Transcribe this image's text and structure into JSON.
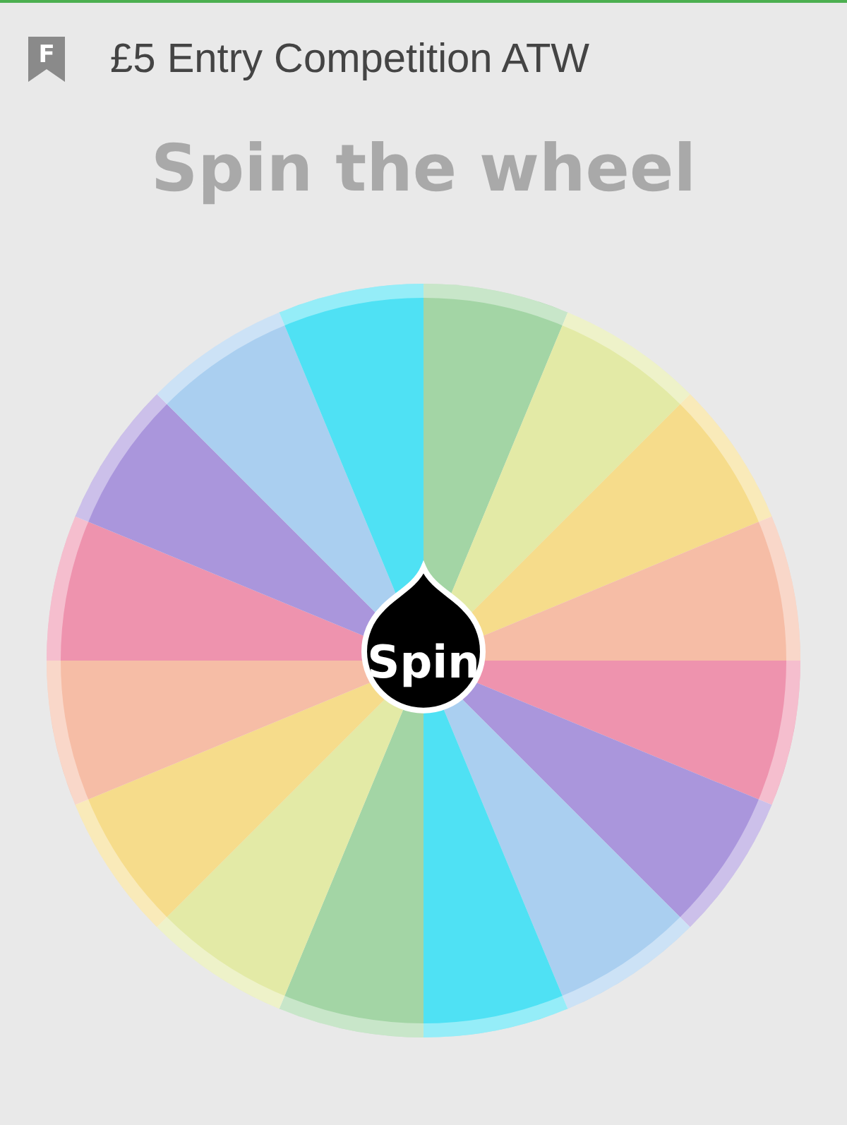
{
  "header": {
    "logo_letter": "F",
    "title": "£5 Entry Competition ATW"
  },
  "heading": "Spin the wheel",
  "wheel": {
    "spin_label": "Spin",
    "segments": [
      {
        "color": "#a3d5a5"
      },
      {
        "color": "#e3eaa6"
      },
      {
        "color": "#f6dc8b"
      },
      {
        "color": "#f6bda6"
      },
      {
        "color": "#ee93ae"
      },
      {
        "color": "#aa96dc"
      },
      {
        "color": "#aacff0"
      },
      {
        "color": "#4fe1f4"
      },
      {
        "color": "#a3d5a5"
      },
      {
        "color": "#e3eaa6"
      },
      {
        "color": "#f6dc8b"
      },
      {
        "color": "#f6bda6"
      },
      {
        "color": "#ee93ae"
      },
      {
        "color": "#aa96dc"
      },
      {
        "color": "#aacff0"
      },
      {
        "color": "#4fe1f4"
      }
    ]
  }
}
